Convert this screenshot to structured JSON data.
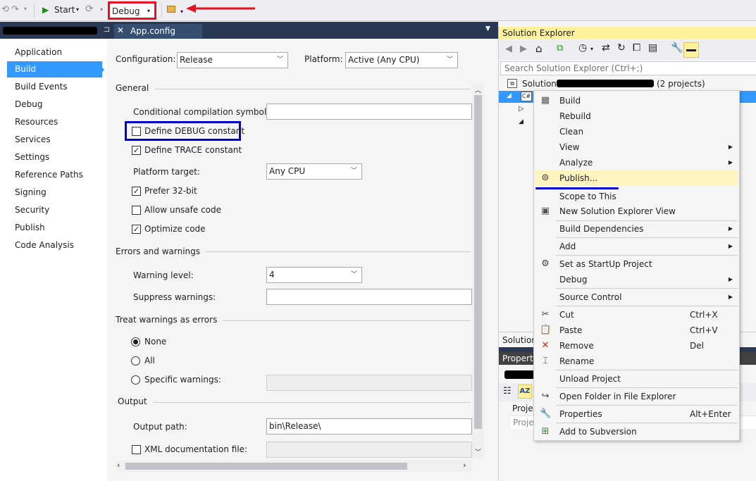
{
  "toolbar": {
    "start_label": "Start",
    "config_value": "Debug"
  },
  "tabs": {
    "app_config": "App.config"
  },
  "nav": {
    "items": [
      "Application",
      "Build",
      "Build Events",
      "Debug",
      "Resources",
      "Services",
      "Settings",
      "Reference Paths",
      "Signing",
      "Security",
      "Publish",
      "Code Analysis"
    ],
    "selected": "Build"
  },
  "build": {
    "configuration_label": "Configuration:",
    "configuration_value": "Release",
    "platform_label": "Platform:",
    "platform_value": "Active (Any CPU)",
    "general_header": "General",
    "cond_symbols_label": "Conditional compilation symbols:",
    "define_debug_label": "Define DEBUG constant",
    "define_trace_label": "Define TRACE constant",
    "platform_target_label": "Platform target:",
    "platform_target_value": "Any CPU",
    "prefer32_label": "Prefer 32-bit",
    "unsafe_label": "Allow unsafe code",
    "optimize_label": "Optimize code",
    "errors_header": "Errors and warnings",
    "warning_level_label": "Warning level:",
    "warning_level_value": "4",
    "suppress_label": "Suppress warnings:",
    "treat_header": "Treat warnings as errors",
    "none_label": "None",
    "all_label": "All",
    "specific_label": "Specific warnings:",
    "output_header": "Output",
    "output_path_label": "Output path:",
    "output_path_value": "bin\\Release\\",
    "xml_doc_label": "XML documentation file:"
  },
  "solution_explorer": {
    "title": "Solution Explorer",
    "search_placeholder": "Search Solution Explorer (Ctrl+;)",
    "solution_prefix": "Solution '",
    "solution_suffix": "(2 projects)",
    "bottom_tab": "Solution"
  },
  "properties": {
    "title": "Properties",
    "row1": "Projec",
    "row2": "Projec"
  },
  "context_menu": {
    "items": [
      {
        "label": "Build",
        "icon": "build-icon"
      },
      {
        "label": "Rebuild"
      },
      {
        "label": "Clean"
      },
      {
        "label": "View",
        "submenu": true
      },
      {
        "label": "Analyze",
        "submenu": true
      },
      {
        "label": "Publish...",
        "icon": "publish-icon",
        "highlighted": true
      },
      {
        "label": "Scope to This"
      },
      {
        "label": "New Solution Explorer View",
        "icon": "new-view-icon"
      },
      {
        "label": "Build Dependencies",
        "submenu": true
      },
      {
        "label": "Add",
        "submenu": true
      },
      {
        "label": "Set as StartUp Project",
        "icon": "gear-icon"
      },
      {
        "label": "Debug",
        "submenu": true
      },
      {
        "label": "Source Control",
        "submenu": true
      },
      {
        "label": "Cut",
        "shortcut": "Ctrl+X",
        "icon": "cut-icon"
      },
      {
        "label": "Paste",
        "shortcut": "Ctrl+V",
        "icon": "paste-icon"
      },
      {
        "label": "Remove",
        "shortcut": "Del",
        "icon": "remove-icon"
      },
      {
        "label": "Rename",
        "icon": "rename-icon"
      },
      {
        "label": "Unload Project"
      },
      {
        "label": "Open Folder in File Explorer",
        "icon": "open-folder-icon"
      },
      {
        "label": "Properties",
        "shortcut": "Alt+Enter",
        "icon": "wrench-icon"
      },
      {
        "label": "Add to Subversion",
        "icon": "subversion-icon"
      }
    ]
  },
  "colors": {
    "red_annotation": "#e81123",
    "blue_annotation": "#0000cc",
    "selection_blue": "#3399ff",
    "title_yellow": "#fff29d",
    "highlight_menu": "#fdf4bf"
  }
}
